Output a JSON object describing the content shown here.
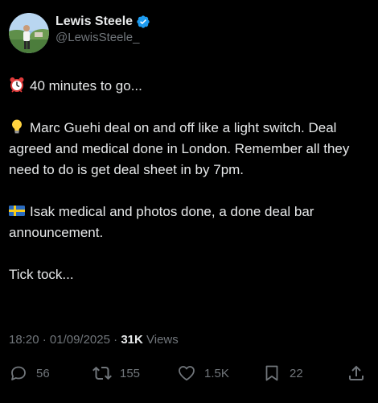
{
  "author": {
    "display_name": "Lewis Steele",
    "handle": "@LewisSteele_",
    "verified": true,
    "verified_color": "#1d9bf0"
  },
  "tweet": {
    "lines": [
      {
        "emoji": "alarm-clock-icon",
        "text": "40 minutes to go..."
      },
      {
        "emoji": "light-bulb-icon",
        "text": "Marc Guehi deal on and off like a light switch. Deal agreed and medical done in London. Remember all they need to do is get deal sheet in by 7pm."
      },
      {
        "emoji": "sweden-flag-icon",
        "text": "Isak medical and photos done, a done deal bar announcement."
      },
      {
        "emoji": "",
        "text": "Tick tock..."
      }
    ]
  },
  "meta": {
    "time": "18:20",
    "separator": "·",
    "date": "01/09/2025",
    "views_count": "31K",
    "views_label": "Views"
  },
  "actions": {
    "replies": "56",
    "reposts": "155",
    "likes": "1.5K",
    "bookmarks": "22"
  },
  "colors": {
    "background": "#000000",
    "text": "#e7e9ea",
    "muted": "#71767b"
  }
}
